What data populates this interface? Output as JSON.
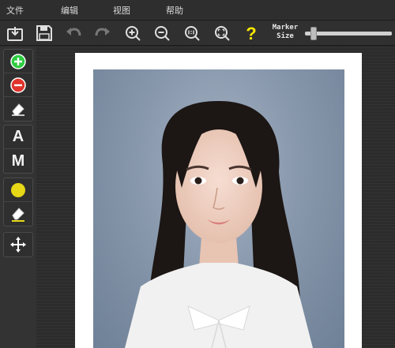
{
  "menu": {
    "items": [
      "文件",
      "编辑",
      "视图",
      "帮助"
    ]
  },
  "toolbar": {
    "marker_label_line1": "Marker",
    "marker_label_line2": "Size",
    "marker_size_level": 0.08,
    "buttons": [
      "import-icon",
      "save-icon",
      "undo-icon",
      "redo-icon",
      "zoom-in-icon",
      "zoom-out-icon",
      "actual-size-icon",
      "fit-icon",
      "help-icon"
    ]
  },
  "sidebar": {
    "letter_a": "A",
    "letter_m": "M"
  },
  "colors": {
    "accent_green": "#2ecc40",
    "accent_red": "#e0342c",
    "accent_yellow": "#e6d817",
    "help_yellow": "#ffe800"
  }
}
